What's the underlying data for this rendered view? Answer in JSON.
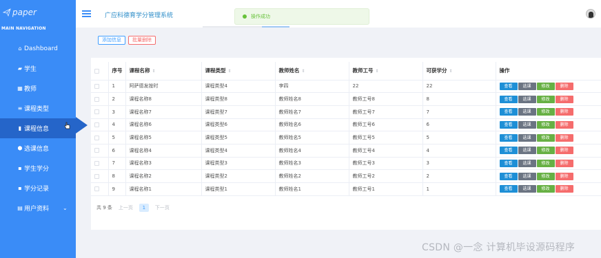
{
  "app": {
    "logo_text": "paper",
    "title": "广应科德育学分管理系统"
  },
  "sidebar": {
    "nav_title": "MAIN NAVIGATION",
    "items": [
      {
        "label": "Dashboard",
        "icon": "home-icon",
        "glyph": "⌂"
      },
      {
        "label": "学生",
        "icon": "comment-icon",
        "glyph": "▰"
      },
      {
        "label": "教师",
        "icon": "card-icon",
        "glyph": "▦"
      },
      {
        "label": "课程类型",
        "icon": "list-icon",
        "glyph": "≡"
      },
      {
        "label": "课程信息",
        "icon": "bar-chart-icon",
        "glyph": "▮"
      },
      {
        "label": "选课信息",
        "icon": "tag-icon",
        "glyph": "⬢"
      },
      {
        "label": "学生学分",
        "icon": "grid-icon",
        "glyph": "▪"
      },
      {
        "label": "学分记录",
        "icon": "grid-icon",
        "glyph": "▪"
      },
      {
        "label": "用户资料",
        "icon": "user-card-icon",
        "glyph": "▤"
      }
    ],
    "active_index": 4
  },
  "toast": {
    "message": "操作成功"
  },
  "toolbar": {
    "add_label": "添加信息",
    "batch_delete_label": "批量删除"
  },
  "table": {
    "columns": [
      "序号",
      "课程名称",
      "课程类型",
      "教师姓名",
      "教师工号",
      "可获学分",
      "操作"
    ],
    "rows": [
      [
        "1",
        "阿萨德发按时",
        "课程类型4",
        "李四",
        "22",
        "22"
      ],
      [
        "2",
        "课程名称8",
        "课程类型8",
        "教师姓名8",
        "教师工号8",
        "8"
      ],
      [
        "3",
        "课程名称7",
        "课程类型7",
        "教师姓名7",
        "教师工号7",
        "7"
      ],
      [
        "4",
        "课程名称6",
        "课程类型6",
        "教师姓名6",
        "教师工号6",
        "6"
      ],
      [
        "5",
        "课程名称5",
        "课程类型5",
        "教师姓名5",
        "教师工号5",
        "5"
      ],
      [
        "6",
        "课程名称4",
        "课程类型4",
        "教师姓名4",
        "教师工号4",
        "4"
      ],
      [
        "7",
        "课程名称3",
        "课程类型3",
        "教师姓名3",
        "教师工号3",
        "3"
      ],
      [
        "8",
        "课程名称2",
        "课程类型2",
        "教师姓名2",
        "教师工号2",
        "2"
      ],
      [
        "9",
        "课程名称1",
        "课程类型1",
        "教师姓名1",
        "教师工号1",
        "1"
      ]
    ],
    "actions": {
      "view": "查看",
      "select": "选课",
      "edit": "修改",
      "delete": "删除"
    }
  },
  "pagination": {
    "total_text": "共 9 条",
    "prev": "上一页",
    "current": "1",
    "next": "下一页"
  },
  "watermark": "CSDN @一念 计算机毕设源码程序",
  "colors": {
    "sidebar": "#3a8cf7",
    "sidebar_active": "#2565c9",
    "view": "#1e8fd6",
    "select": "#6b7482",
    "edit": "#67b044",
    "delete": "#f56c6c",
    "success": "#67c23a"
  }
}
